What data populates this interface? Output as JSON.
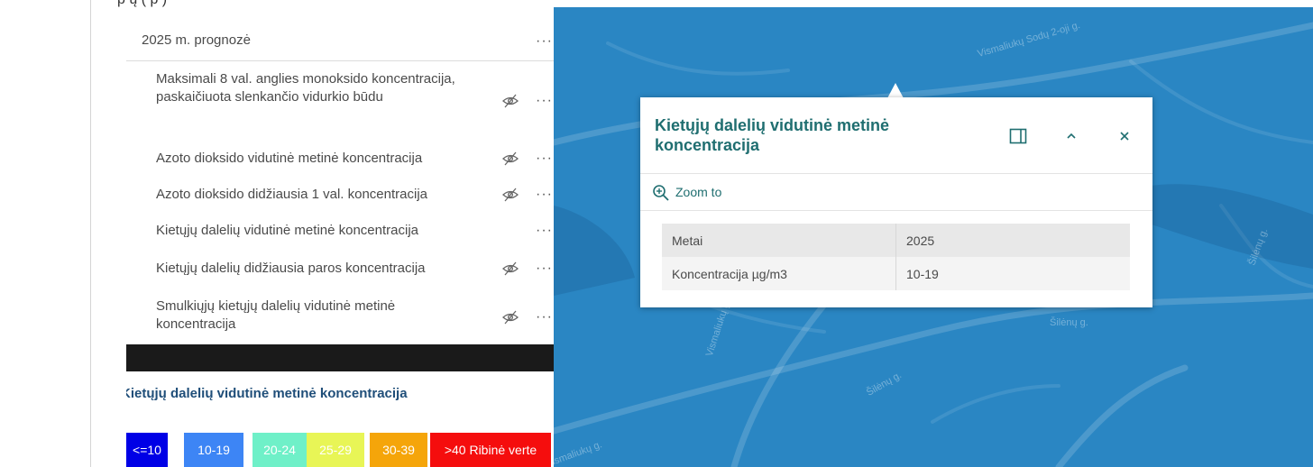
{
  "page": {
    "cut_top_text": "p                                                    ų (          p         )"
  },
  "layer_list": {
    "group_title": "2025 m. prognozė",
    "more_glyph": "···",
    "layers": [
      {
        "label": "Maksimali 8 val. anglies monoksido koncentracija, paskaičiuota slenkančio vidurkio būdu",
        "hidden": true
      },
      {
        "label": "Azoto dioksido vidutinė metinė koncentracija",
        "hidden": true
      },
      {
        "label": "Azoto dioksido didžiausia 1 val. koncentracija",
        "hidden": true
      },
      {
        "label": "Kietųjų dalelių vidutinė metinė koncentracija",
        "hidden": false
      },
      {
        "label": "Kietųjų dalelių didžiausia paros koncentracija",
        "hidden": true
      },
      {
        "label": "Smulkiųjų kietųjų dalelių vidutinė metinė koncentracija",
        "hidden": true
      }
    ]
  },
  "legend": {
    "title": "Kietųjų dalelių vidutinė metinė koncentracija",
    "classes": [
      {
        "label": "<=10",
        "color": "#0000e6"
      },
      {
        "label": "10-19",
        "color": "#3d85f5"
      },
      {
        "label": "20-24",
        "color": "#6ff0c8"
      },
      {
        "label": "25-29",
        "color": "#e8f556"
      },
      {
        "label": "30-39",
        "color": "#f5a50a"
      },
      {
        "label": ">40 Ribinė verte",
        "color": "#f50d0d"
      }
    ]
  },
  "map": {
    "background": "#2a86c3",
    "streets": [
      {
        "label": "Vismaliukų Sodų 2-oji g."
      },
      {
        "label": "Vismaliukų g."
      },
      {
        "label": "Šilėnų g."
      },
      {
        "label": "Šilėnų g."
      },
      {
        "label": "Šilėnų g."
      },
      {
        "label": "Vismaliukų g."
      }
    ]
  },
  "popup": {
    "title": "Kietųjų dalelių vidutinė metinė koncentracija",
    "zoom_to_label": "Zoom to",
    "rows": [
      {
        "key": "Metai",
        "value": "2025"
      },
      {
        "key": "Koncentracija µg/m3",
        "value": "10-19"
      }
    ],
    "accent_color": "#1f6e70"
  }
}
